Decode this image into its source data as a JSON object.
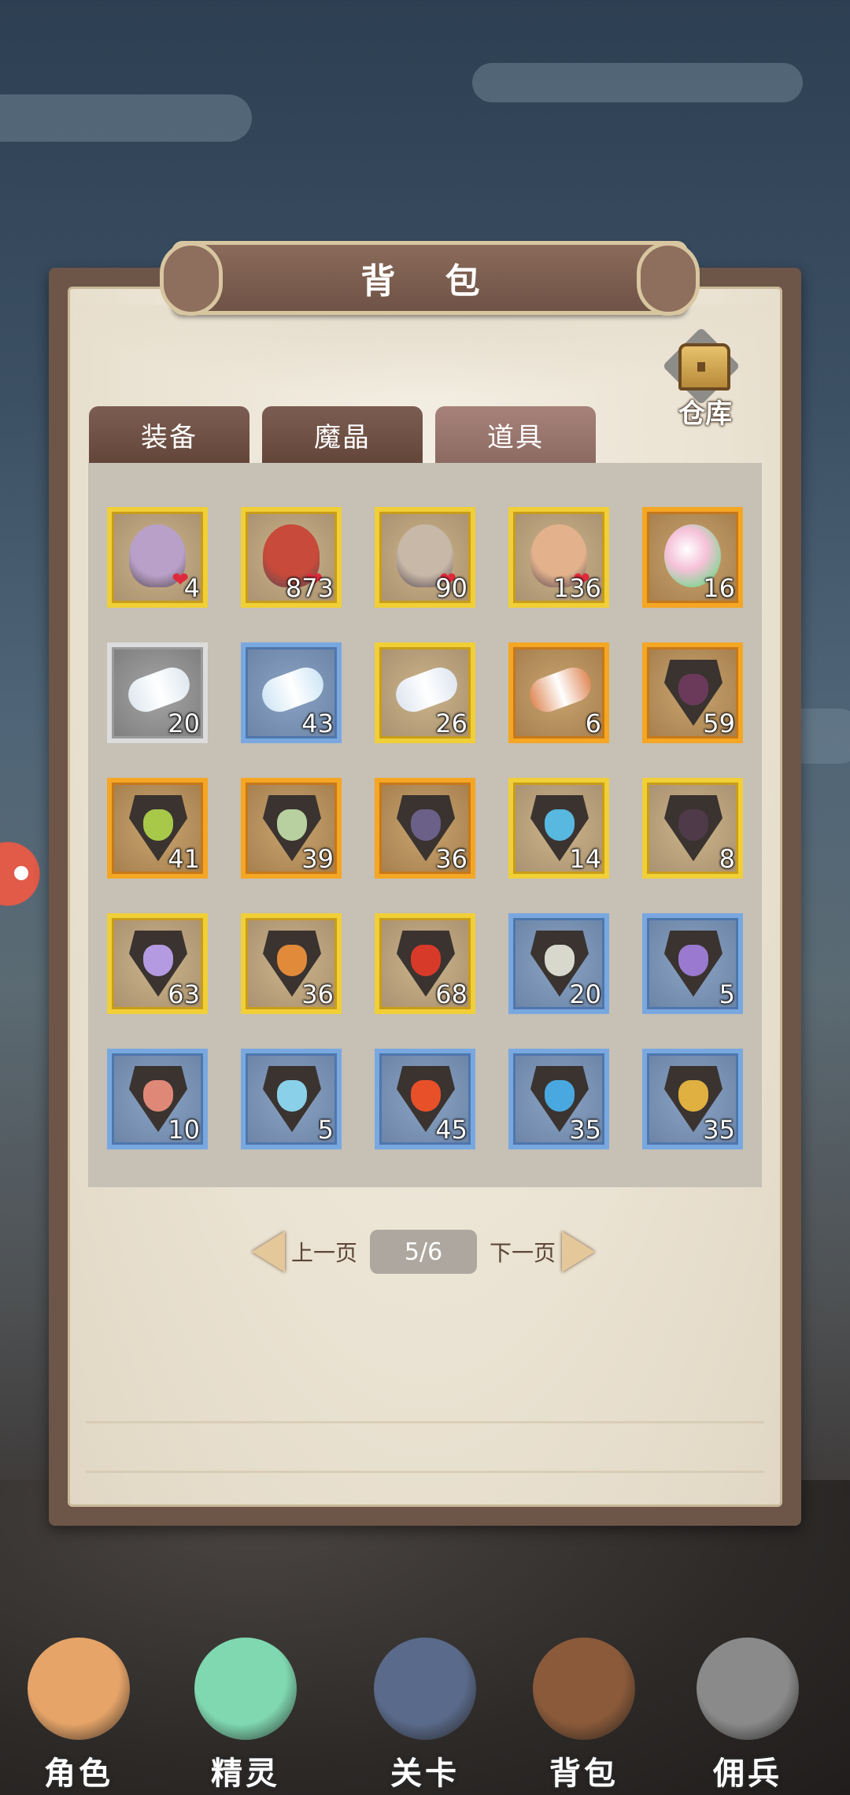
{
  "panel": {
    "title": "背 包",
    "warehouse_label": "仓库"
  },
  "tabs": [
    {
      "label": "装备",
      "active": false
    },
    {
      "label": "魔晶",
      "active": false
    },
    {
      "label": "道具",
      "active": true
    }
  ],
  "items": [
    {
      "icon": "dark-elf-portrait-icon",
      "frame": "gold",
      "count": "4",
      "heart": true,
      "color": "#b9a0c8"
    },
    {
      "icon": "red-hair-girl-portrait-icon",
      "frame": "gold",
      "count": "873",
      "heart": true,
      "color": "#c84a3a"
    },
    {
      "icon": "white-hair-girl-portrait-icon",
      "frame": "gold",
      "count": "90",
      "heart": true,
      "color": "#c7b8a8"
    },
    {
      "icon": "bald-monk-portrait-icon",
      "frame": "gold",
      "count": "136",
      "heart": true,
      "color": "#e3b28c"
    },
    {
      "icon": "rainbow-orb-icon",
      "frame": "orange",
      "count": "16",
      "heart": false,
      "color": "#f0c4dc"
    },
    {
      "icon": "silver-scroll-icon",
      "frame": "gray",
      "count": "20",
      "heart": false,
      "color": "#dfe8ef"
    },
    {
      "icon": "blue-scroll-icon",
      "frame": "blue",
      "count": "43",
      "heart": false,
      "color": "#cfe6f5"
    },
    {
      "icon": "gold-scroll-icon",
      "frame": "gold",
      "count": "26",
      "heart": false,
      "color": "#dfe6f0"
    },
    {
      "icon": "copper-scroll-icon",
      "frame": "orange",
      "count": "6",
      "heart": false,
      "color": "#e08a5a"
    },
    {
      "icon": "black-dragon-shield-icon",
      "frame": "orange",
      "count": "59",
      "heart": false,
      "color": "#6b3a5a"
    },
    {
      "icon": "green-dragon-shield-icon",
      "frame": "orange",
      "count": "41",
      "heart": false,
      "color": "#a8c84a"
    },
    {
      "icon": "pale-green-dragon-shield-icon",
      "frame": "orange",
      "count": "39",
      "heart": false,
      "color": "#b8d0a0"
    },
    {
      "icon": "purple-dragon-shield-icon",
      "frame": "orange",
      "count": "36",
      "heart": false,
      "color": "#6a6088"
    },
    {
      "icon": "cyan-dragon-shield-icon",
      "frame": "gold",
      "count": "14",
      "heart": false,
      "color": "#58b8e0"
    },
    {
      "icon": "dark-dragon-shield-icon",
      "frame": "gold",
      "count": "8",
      "heart": false,
      "color": "#4e3a48"
    },
    {
      "icon": "lilac-dragon-shield-icon",
      "frame": "gold",
      "count": "63",
      "heart": false,
      "color": "#b49ae0"
    },
    {
      "icon": "orange-dragon-shield-icon",
      "frame": "gold",
      "count": "36",
      "heart": false,
      "color": "#e08a3a"
    },
    {
      "icon": "red-dragon-shield-icon",
      "frame": "gold",
      "count": "68",
      "heart": false,
      "color": "#d83a2a"
    },
    {
      "icon": "white-dragon-shield-icon",
      "frame": "blue",
      "count": "20",
      "heart": false,
      "color": "#d8d8cc"
    },
    {
      "icon": "violet-dragon-shield-icon",
      "frame": "blue",
      "count": "5",
      "heart": false,
      "color": "#9a7ad0"
    },
    {
      "icon": "coral-dragon-shield-icon",
      "frame": "blue",
      "count": "10",
      "heart": false,
      "color": "#e08878"
    },
    {
      "icon": "ice-dragon-shield-icon",
      "frame": "blue",
      "count": "5",
      "heart": false,
      "color": "#8ad0e8"
    },
    {
      "icon": "fire-dragon-shield-icon",
      "frame": "blue",
      "count": "45",
      "heart": false,
      "color": "#e8502a"
    },
    {
      "icon": "sky-dragon-shield-icon",
      "frame": "blue",
      "count": "35",
      "heart": false,
      "color": "#4aa8e0"
    },
    {
      "icon": "golden-dragon-shield-icon",
      "frame": "blue",
      "count": "35",
      "heart": false,
      "color": "#e0b040"
    }
  ],
  "pager": {
    "prev_label": "上一页",
    "page": "5/6",
    "next_label": "下一页"
  },
  "bottom_nav": [
    {
      "label": "角色",
      "icon": "hero-portrait-icon",
      "color": "#e6a468"
    },
    {
      "label": "精灵",
      "icon": "green-slime-icon",
      "color": "#7fd8b0"
    },
    {
      "label": "关卡",
      "icon": "castle-gate-icon",
      "color": "#5a6a8a"
    },
    {
      "label": "背包",
      "icon": "backpack-icon",
      "color": "#8a5a3a"
    },
    {
      "label": "佣兵",
      "icon": "knight-helmet-icon",
      "color": "#8a8a8a"
    }
  ]
}
